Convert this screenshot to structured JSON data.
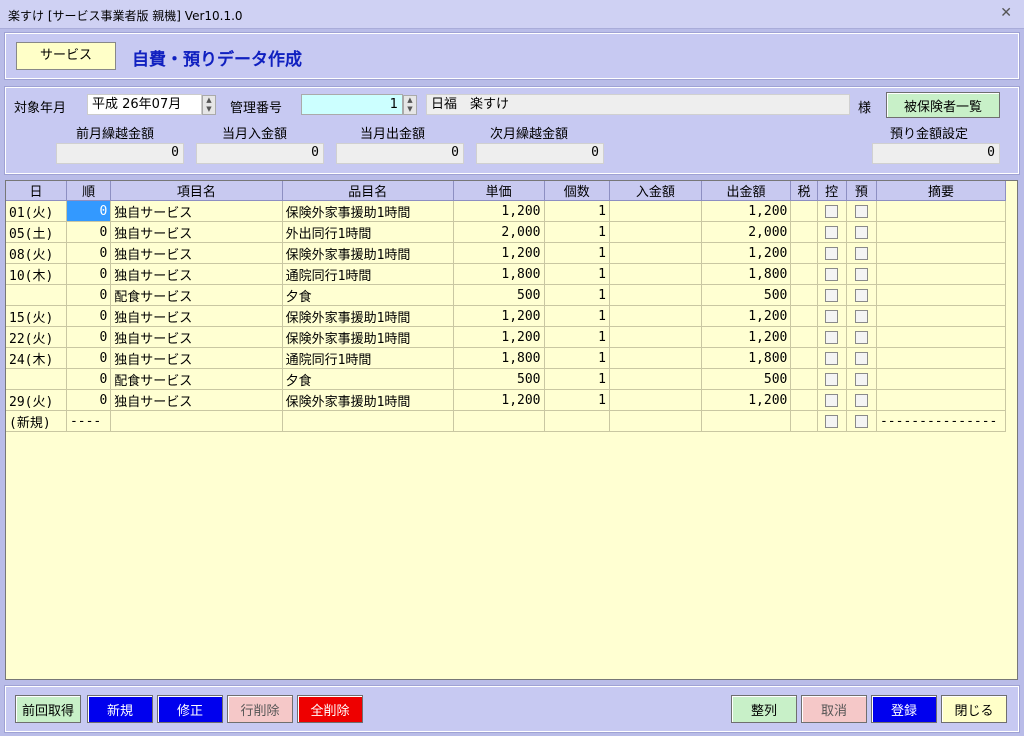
{
  "window": {
    "title": "楽すけ [サービス事業者版 親機] Ver10.1.0"
  },
  "header": {
    "tab_label": "サービス",
    "screen_title": "自費・預りデータ作成"
  },
  "filters": {
    "year_month_label": "対象年月",
    "year_month_value": "平成 26年07月",
    "mgmt_no_label": "管理番号",
    "mgmt_no_value": "1",
    "patient_name": "日福　楽すけ",
    "honorific": "様",
    "insured_list_button": "被保険者一覧",
    "prev_carry_label": "前月繰越金額",
    "prev_carry_value": "0",
    "month_in_label": "当月入金額",
    "month_in_value": "0",
    "month_out_label": "当月出金額",
    "month_out_value": "0",
    "next_carry_label": "次月繰越金額",
    "next_carry_value": "0",
    "deposit_setting_label": "預り金額設定",
    "deposit_setting_value": "0"
  },
  "table": {
    "headers": [
      "日",
      "順",
      "項目名",
      "品目名",
      "単価",
      "個数",
      "入金額",
      "出金額",
      "税",
      "控",
      "預",
      "摘要"
    ],
    "rows": [
      {
        "day": "01(火)",
        "order": "0",
        "item": "独自サービス",
        "product": "保険外家事援助1時間",
        "price": "1,200",
        "qty": "1",
        "in": "",
        "out": "1,200"
      },
      {
        "day": "05(土)",
        "order": "0",
        "item": "独自サービス",
        "product": "外出同行1時間",
        "price": "2,000",
        "qty": "1",
        "in": "",
        "out": "2,000"
      },
      {
        "day": "08(火)",
        "order": "0",
        "item": "独自サービス",
        "product": "保険外家事援助1時間",
        "price": "1,200",
        "qty": "1",
        "in": "",
        "out": "1,200"
      },
      {
        "day": "10(木)",
        "order": "0",
        "item": "独自サービス",
        "product": "通院同行1時間",
        "price": "1,800",
        "qty": "1",
        "in": "",
        "out": "1,800"
      },
      {
        "day": "",
        "order": "0",
        "item": "配食サービス",
        "product": "夕食",
        "price": "500",
        "qty": "1",
        "in": "",
        "out": "500"
      },
      {
        "day": "15(火)",
        "order": "0",
        "item": "独自サービス",
        "product": "保険外家事援助1時間",
        "price": "1,200",
        "qty": "1",
        "in": "",
        "out": "1,200"
      },
      {
        "day": "22(火)",
        "order": "0",
        "item": "独自サービス",
        "product": "保険外家事援助1時間",
        "price": "1,200",
        "qty": "1",
        "in": "",
        "out": "1,200"
      },
      {
        "day": "24(木)",
        "order": "0",
        "item": "独自サービス",
        "product": "通院同行1時間",
        "price": "1,800",
        "qty": "1",
        "in": "",
        "out": "1,800"
      },
      {
        "day": "",
        "order": "0",
        "item": "配食サービス",
        "product": "夕食",
        "price": "500",
        "qty": "1",
        "in": "",
        "out": "500"
      },
      {
        "day": "29(火)",
        "order": "0",
        "item": "独自サービス",
        "product": "保険外家事援助1時間",
        "price": "1,200",
        "qty": "1",
        "in": "",
        "out": "1,200"
      }
    ],
    "new_row": {
      "day": "(新規)",
      "order": "----",
      "memo": "---------------"
    }
  },
  "footer": {
    "prev_fetch": "前回取得",
    "new": "新規",
    "edit": "修正",
    "delete_row": "行削除",
    "delete_all": "全削除",
    "sort": "整列",
    "cancel": "取消",
    "register": "登録",
    "close": "閉じる"
  },
  "colors": {
    "background": "#b9bce8",
    "grid_bg": "#ffffd2",
    "blue_button": "#0000ee",
    "red_button": "#ee0000",
    "green_button": "#c8f0c8",
    "pink_button": "#f5c8c8",
    "selected_cell": "#3399ff"
  }
}
